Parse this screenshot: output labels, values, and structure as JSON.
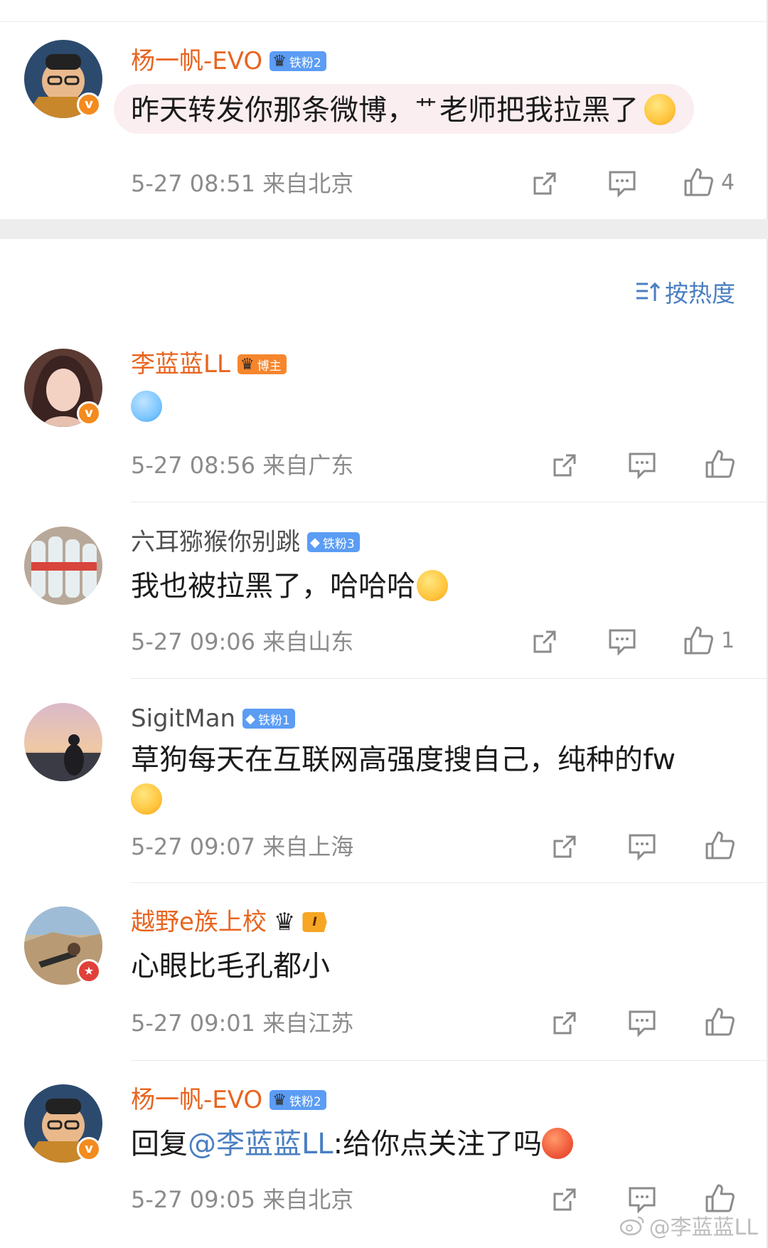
{
  "top_comment": {
    "name": "杨一帆-EVO",
    "badge": "铁粉2",
    "text_before": "昨天转发你那条微博，",
    "text_glyph": "艹",
    "text_after": "老师把我拉黑了",
    "meta": "5-27 08:51  来自北京",
    "likes": "4"
  },
  "sort": {
    "label": "按热度"
  },
  "comments": [
    {
      "name": "李蓝蓝LL",
      "badge": "博主",
      "text": "",
      "meta": "5-27 08:56  来自广东",
      "likes": ""
    },
    {
      "name": "六耳猕猴你别跳",
      "badge": "铁粉3",
      "text": "我也被拉黑了，哈哈哈",
      "meta": "5-27 09:06  来自山东",
      "likes": "1"
    },
    {
      "name": "SigitMan",
      "badge": "铁粉1",
      "text": "草狗每天在互联网高强度搜自己，纯种的fw",
      "meta": "5-27 09:07  来自上海",
      "likes": ""
    },
    {
      "name": "越野e族上校",
      "badge": "I",
      "text": "心眼比毛孔都小",
      "meta": "5-27 09:01  来自江苏",
      "likes": ""
    },
    {
      "name": "杨一帆-EVO",
      "badge": "铁粉2",
      "reply_prefix": "回复",
      "mention": "@李蓝蓝LL",
      "text": ":给你点关注了吗",
      "meta": "5-27 09:05  来自北京",
      "likes": ""
    }
  ],
  "watermark": "@李蓝蓝LL",
  "icons": {
    "share": "share-icon",
    "comment": "comment-icon",
    "like": "like-icon",
    "sort": "sort-icon"
  },
  "colors": {
    "name_orange": "#e8641f",
    "link_blue": "#4a7fc1",
    "meta_gray": "#8b8b8b"
  }
}
